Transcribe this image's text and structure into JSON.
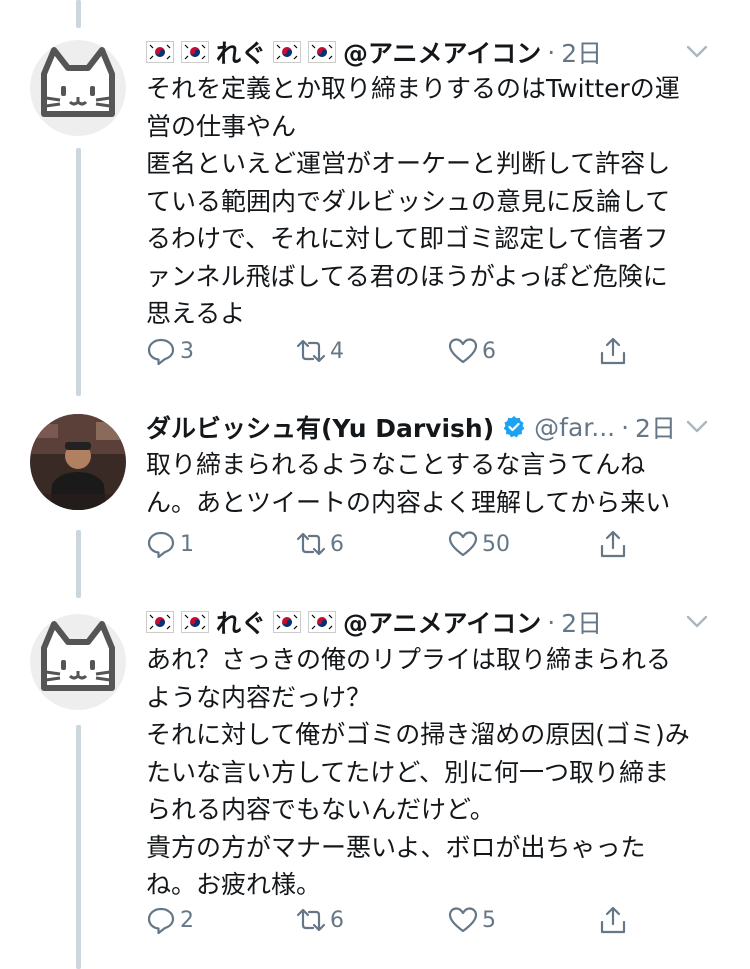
{
  "tweets": [
    {
      "name": "れぐ",
      "handle": "@アニメアイコン",
      "dot": "·",
      "time": "2日",
      "lines": [
        "それを定義とか取り締まりするのはTwitterの運",
        "営の仕事やん",
        "匿名といえど運営がオーケーと判断して許容し",
        "ている範囲内でダルビッシュの意見に反論して",
        "るわけで、それに対して即ゴミ認定して信者フ",
        "ァンネル飛ばしてる君のほうがよっぽど危険に",
        "思えるよ"
      ],
      "replies": "3",
      "retweets": "4",
      "likes": "6"
    },
    {
      "name": "ダルビッシュ有(Yu Darvish)",
      "handle": "@far...",
      "dot": "·",
      "time": "2日",
      "lines": [
        "取り締まられるようなことするな言うてんね",
        "ん。あとツイートの内容よく理解してから来い"
      ],
      "replies": "1",
      "retweets": "6",
      "likes": "50"
    },
    {
      "name": "れぐ",
      "handle": "@アニメアイコン",
      "dot": "·",
      "time": "2日",
      "lines": [
        "あれ？さっきの俺のリプライは取り締まられる",
        "ような内容だっけ？",
        "それに対して俺がゴミの掃き溜めの原因(ゴミ)み",
        "たいな言い方してたけど、別に何一つ取り締ま",
        "られる内容でもないんだけど。",
        "貴方の方がマナー悪いよ、ボロが出ちゃった",
        "ね。お疲れ様。"
      ],
      "replies": "2",
      "retweets": "6",
      "likes": "5"
    }
  ],
  "icons": {
    "flag": "korean-flag-icon",
    "cat_avatar": "cat-face-icon",
    "verified": "verified-badge-icon",
    "chevron": "chevron-down-icon",
    "reply": "reply-icon",
    "retweet": "retweet-icon",
    "like": "heart-icon",
    "share": "share-icon"
  },
  "colors": {
    "text": "#14171a",
    "secondary": "#657786",
    "verified": "#1da1f2",
    "thread_line": "#ccd6dd"
  }
}
